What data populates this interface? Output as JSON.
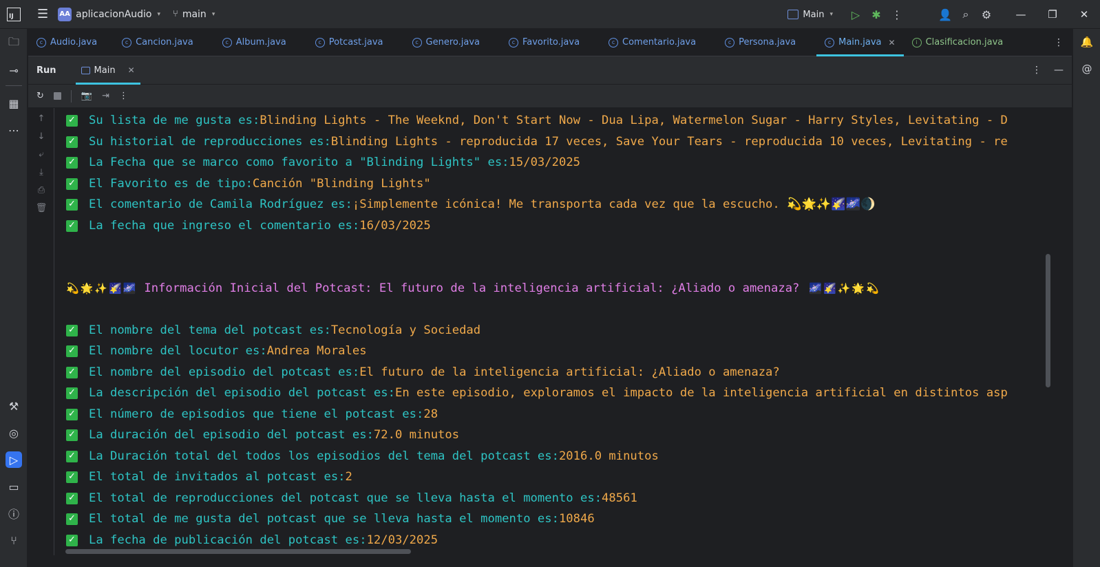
{
  "titlebar": {
    "project_badge": "AA",
    "project_name": "aplicacionAudio",
    "branch": "main",
    "run_config": "Main"
  },
  "editor_tabs": [
    {
      "label": "Audio.java",
      "icon": "class-icon"
    },
    {
      "label": "Cancion.java",
      "icon": "class-icon"
    },
    {
      "label": "Album.java",
      "icon": "class-icon"
    },
    {
      "label": "Potcast.java",
      "icon": "class-icon"
    },
    {
      "label": "Genero.java",
      "icon": "class-icon"
    },
    {
      "label": "Favorito.java",
      "icon": "class-icon"
    },
    {
      "label": "Comentario.java",
      "icon": "class-icon"
    },
    {
      "label": "Persona.java",
      "icon": "class-icon"
    },
    {
      "label": "Main.java",
      "icon": "class-run-icon",
      "active": true
    },
    {
      "label": "Clasificacion.java",
      "icon": "interface-icon"
    }
  ],
  "run_panel": {
    "title": "Run",
    "tab_label": "Main"
  },
  "console": {
    "lines": [
      {
        "label": "Su lista de me gusta es: ",
        "value": "Blinding Lights - The Weeknd, Don't Start Now - Dua Lipa, Watermelon Sugar - Harry Styles, Levitating - D"
      },
      {
        "label": "Su historial de reproducciones es: ",
        "value": "Blinding Lights - reproducida 17 veces, Save Your Tears - reproducida 10 veces, Levitating - re"
      },
      {
        "label": "La Fecha que se marco como favorito a \"Blinding Lights\" es: ",
        "value": "15/03/2025"
      },
      {
        "label": "El Favorito es de tipo: ",
        "value": "Canción \"Blinding Lights\""
      },
      {
        "label": "El comentario de Camila Rodríguez es: ",
        "value": "¡Simplemente icónica! Me transporta cada vez que la escucho. 💫🌟✨🌠🌌🌒"
      },
      {
        "label": "La fecha que ingreso el comentario es: ",
        "value": "16/03/2025"
      }
    ],
    "heading": {
      "prefix": "💫🌟✨🌠🌌",
      "text": "Información Inicial del Potcast: El futuro de la inteligencia artificial: ¿Aliado o amenaza?",
      "suffix": "🌌🌠✨🌟💫"
    },
    "podcast_lines": [
      {
        "label": "El nombre del tema del potcast es: ",
        "value": "Tecnología y Sociedad"
      },
      {
        "label": "El nombre del locutor es: ",
        "value": "Andrea Morales"
      },
      {
        "label": "El nombre del episodio del potcast es: ",
        "value": "El futuro de la inteligencia artificial: ¿Aliado o amenaza?"
      },
      {
        "label": "La descripción del episodio del potcast es: ",
        "value": "En este episodio, exploramos el impacto de la inteligencia artificial en distintos asp"
      },
      {
        "label": "El número de episodios que tiene el potcast es: ",
        "value": "28"
      },
      {
        "label": "La duración del episodio del potcast es: ",
        "value": "72.0 minutos"
      },
      {
        "label": "La Duración total del todos los episodios del tema del potcast es: ",
        "value": "2016.0 minutos"
      },
      {
        "label": "El total de invitados al potcast es: ",
        "value": "2"
      },
      {
        "label": "El total de reproducciones del potcast que se lleva hasta el momento es: ",
        "value": "48561"
      },
      {
        "label": "El total de me gusta del potcast que se lleva hasta el momento es: ",
        "value": "10846"
      },
      {
        "label": "La fecha de publicación del potcast es: ",
        "value": "12/03/2025"
      }
    ]
  }
}
